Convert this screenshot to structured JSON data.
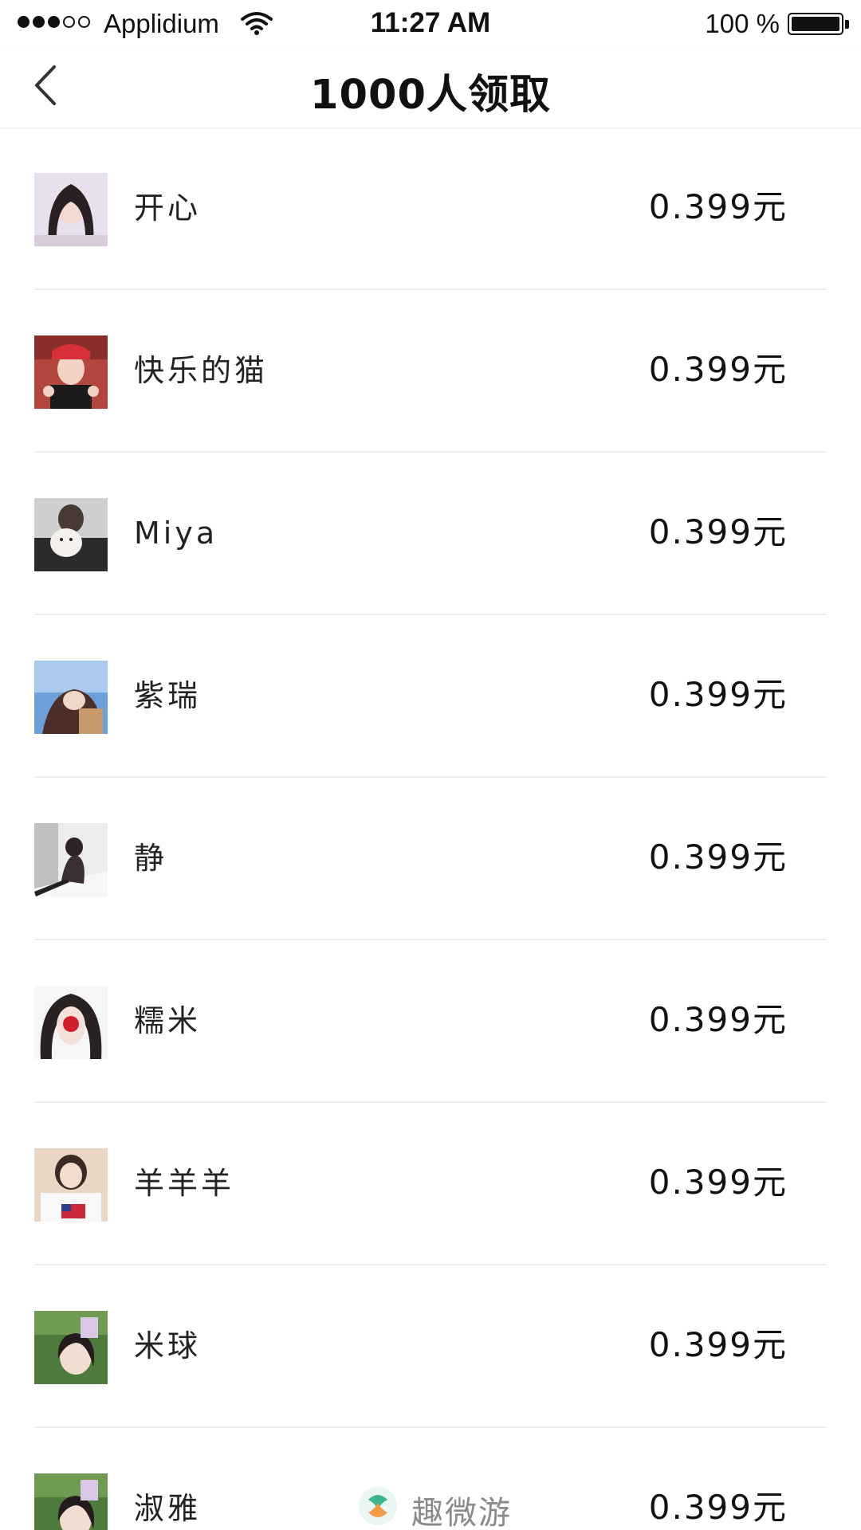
{
  "status_bar": {
    "carrier": "Applidium",
    "time": "11:27 AM",
    "battery": "100 %",
    "battery_level": 1.0
  },
  "nav": {
    "title": "1000人领取"
  },
  "list": [
    {
      "name": "开心",
      "amount": "0.399元"
    },
    {
      "name": "快乐的猫",
      "amount": "0.399元"
    },
    {
      "name": "Miya",
      "amount": "0.399元"
    },
    {
      "name": "紫瑞",
      "amount": "0.399元"
    },
    {
      "name": "静",
      "amount": "0.399元"
    },
    {
      "name": "糯米",
      "amount": "0.399元"
    },
    {
      "name": "羊羊羊",
      "amount": "0.399元"
    },
    {
      "name": "米球",
      "amount": "0.399元"
    },
    {
      "name": "淑雅",
      "amount": "0.399元"
    }
  ],
  "watermark": {
    "text": "趣微游",
    "icon": "quweiyou-logo-icon"
  }
}
